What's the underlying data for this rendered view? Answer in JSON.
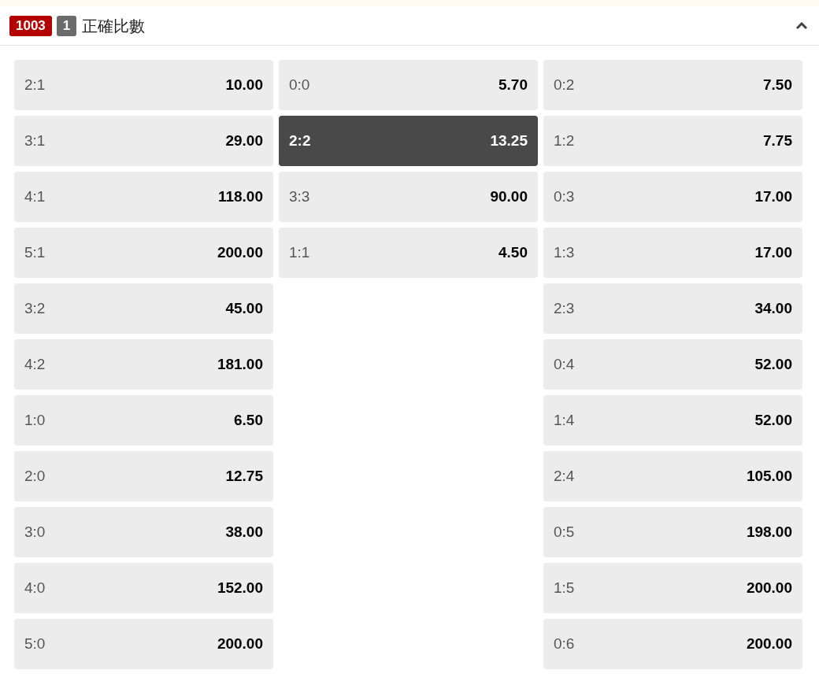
{
  "header": {
    "match_number": "1003",
    "count": "1",
    "title": "正確比數",
    "expanded": true
  },
  "columns": [
    {
      "cells": [
        {
          "score": "2:1",
          "odds": "10.00",
          "selected": false
        },
        {
          "score": "3:1",
          "odds": "29.00",
          "selected": false
        },
        {
          "score": "4:1",
          "odds": "118.00",
          "selected": false
        },
        {
          "score": "5:1",
          "odds": "200.00",
          "selected": false
        },
        {
          "score": "3:2",
          "odds": "45.00",
          "selected": false
        },
        {
          "score": "4:2",
          "odds": "181.00",
          "selected": false
        },
        {
          "score": "1:0",
          "odds": "6.50",
          "selected": false
        },
        {
          "score": "2:0",
          "odds": "12.75",
          "selected": false
        },
        {
          "score": "3:0",
          "odds": "38.00",
          "selected": false
        },
        {
          "score": "4:0",
          "odds": "152.00",
          "selected": false
        },
        {
          "score": "5:0",
          "odds": "200.00",
          "selected": false
        }
      ]
    },
    {
      "cells": [
        {
          "score": "0:0",
          "odds": "5.70",
          "selected": false
        },
        {
          "score": "2:2",
          "odds": "13.25",
          "selected": true
        },
        {
          "score": "3:3",
          "odds": "90.00",
          "selected": false
        },
        {
          "score": "1:1",
          "odds": "4.50",
          "selected": false
        }
      ]
    },
    {
      "cells": [
        {
          "score": "0:2",
          "odds": "7.50",
          "selected": false
        },
        {
          "score": "1:2",
          "odds": "7.75",
          "selected": false
        },
        {
          "score": "0:3",
          "odds": "17.00",
          "selected": false
        },
        {
          "score": "1:3",
          "odds": "17.00",
          "selected": false
        },
        {
          "score": "2:3",
          "odds": "34.00",
          "selected": false
        },
        {
          "score": "0:4",
          "odds": "52.00",
          "selected": false
        },
        {
          "score": "1:4",
          "odds": "52.00",
          "selected": false
        },
        {
          "score": "2:4",
          "odds": "105.00",
          "selected": false
        },
        {
          "score": "0:5",
          "odds": "198.00",
          "selected": false
        },
        {
          "score": "1:5",
          "odds": "200.00",
          "selected": false
        },
        {
          "score": "0:6",
          "odds": "200.00",
          "selected": false
        }
      ]
    }
  ]
}
